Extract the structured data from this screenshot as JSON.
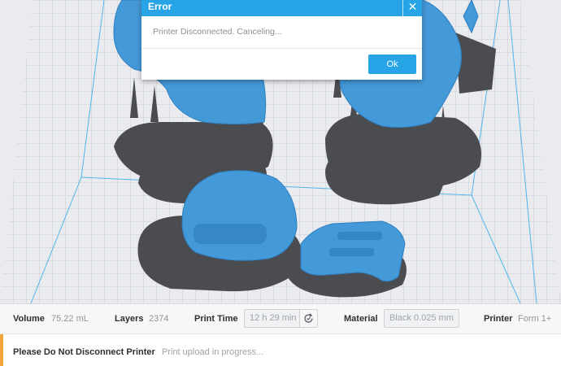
{
  "dialog": {
    "title": "Error",
    "message": "Printer Disconnected. Canceling...",
    "ok_label": "Ok",
    "close_symbol": "✕"
  },
  "info_bar": {
    "volume_label": "Volume",
    "volume_value": "75.22 mL",
    "layers_label": "Layers",
    "layers_value": "2374",
    "print_time_label": "Print Time",
    "print_time_value": "12 h 29 min",
    "material_label": "Material",
    "material_value": "Black 0.025 mm",
    "printer_label": "Printer",
    "printer_value": "Form 1+"
  },
  "status_bar": {
    "title": "Please Do Not Disconnect Printer",
    "message": "Print upload in progress..."
  },
  "colors": {
    "accent": "#27a4e6",
    "model": "#4499d8",
    "support": "#4a4c50",
    "warning": "#f3a43a"
  },
  "icons": [
    "close-icon",
    "refresh-icon"
  ]
}
